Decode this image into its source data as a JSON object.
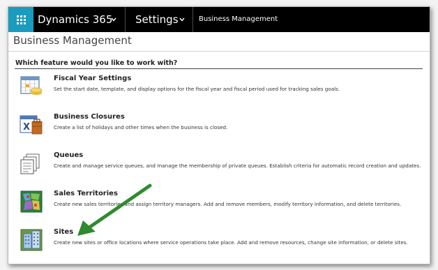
{
  "topbar": {
    "app_name": "Dynamics 365",
    "area": "Settings",
    "breadcrumb": "Business Management"
  },
  "page": {
    "title": "Business Management",
    "question": "Which feature would you like to work with?"
  },
  "features": [
    {
      "name": "Fiscal Year Settings",
      "description": "Set the start date, template, and display options for the fiscal year and fiscal period used for tracking sales goals.",
      "icon": "fiscal-year-icon"
    },
    {
      "name": "Business Closures",
      "description": "Create a list of holidays and other times when the business is closed.",
      "icon": "business-closures-icon"
    },
    {
      "name": "Queues",
      "description": "Create and manage service queues, and manage the membership of private queues. Establish criteria for automatic record creation and updates.",
      "icon": "queues-icon"
    },
    {
      "name": "Sales Territories",
      "description": "Create new sales territories and assign territory managers. Add and remove members, modify territory information, and delete territories.",
      "icon": "sales-territories-icon"
    },
    {
      "name": "Sites",
      "description": "Create new sites or office locations where service operations take place. Add and remove resources, change site information, or delete sites.",
      "icon": "sites-icon"
    }
  ],
  "colors": {
    "waffle": "#1b9bbd",
    "topbar": "#000000",
    "arrow": "#2e8b2e"
  }
}
